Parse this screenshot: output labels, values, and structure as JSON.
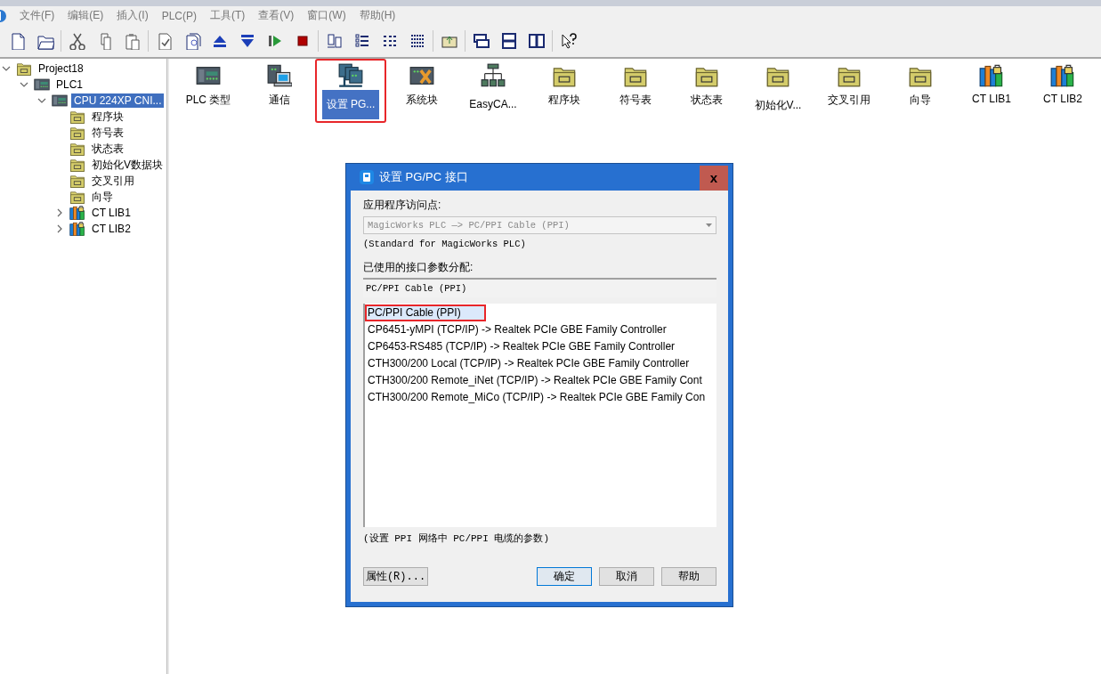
{
  "menu": [
    "文件(F)",
    "编辑(E)",
    "插入(I)",
    "PLC(P)",
    "工具(T)",
    "查看(V)",
    "窗口(W)",
    "帮助(H)"
  ],
  "tree": [
    {
      "label": "Project18",
      "kind": "project",
      "expanded": true,
      "selected": false,
      "children": [
        {
          "label": "PLC1",
          "kind": "plc",
          "expanded": true,
          "selected": false,
          "children": [
            {
              "label": "CPU 224XP CNI...",
              "kind": "plc",
              "expanded": true,
              "selected": true,
              "children": [
                {
                  "label": "程序块",
                  "kind": "folder",
                  "selected": false
                },
                {
                  "label": "符号表",
                  "kind": "folder",
                  "selected": false
                },
                {
                  "label": "状态表",
                  "kind": "folder",
                  "selected": false
                },
                {
                  "label": "初始化V数据块",
                  "kind": "folder",
                  "selected": false
                },
                {
                  "label": "交叉引用",
                  "kind": "folder",
                  "selected": false
                },
                {
                  "label": "向导",
                  "kind": "folder",
                  "selected": false
                },
                {
                  "label": "CT LIB1",
                  "kind": "library",
                  "expanded": false,
                  "selected": false
                },
                {
                  "label": "CT LIB2",
                  "kind": "library",
                  "expanded": false,
                  "selected": false
                }
              ]
            }
          ]
        }
      ]
    }
  ],
  "shortcuts": [
    {
      "label": "PLC 类型",
      "kind": "plc",
      "selected": false,
      "highlighted": false
    },
    {
      "label": "通信",
      "kind": "comm",
      "selected": false,
      "highlighted": false
    },
    {
      "label": "设置 PG...",
      "kind": "setpg",
      "selected": true,
      "highlighted": true
    },
    {
      "label": "系统块",
      "kind": "system",
      "selected": false,
      "highlighted": false
    },
    {
      "label": "EasyCA...",
      "kind": "network",
      "selected": false,
      "highlighted": false
    },
    {
      "label": "程序块",
      "kind": "folder",
      "selected": false,
      "highlighted": false
    },
    {
      "label": "符号表",
      "kind": "folder",
      "selected": false,
      "highlighted": false
    },
    {
      "label": "状态表",
      "kind": "folder",
      "selected": false,
      "highlighted": false
    },
    {
      "label": "初始化V...",
      "kind": "folder",
      "selected": false,
      "highlighted": false
    },
    {
      "label": "交叉引用",
      "kind": "folder",
      "selected": false,
      "highlighted": false
    },
    {
      "label": "向导",
      "kind": "folder",
      "selected": false,
      "highlighted": false
    },
    {
      "label": "CT LIB1",
      "kind": "library",
      "selected": false,
      "highlighted": false
    },
    {
      "label": "CT LIB2",
      "kind": "library",
      "selected": false,
      "highlighted": false
    }
  ],
  "dialog": {
    "title": "设置 PG/PC 接口",
    "close": "x",
    "access_label": "应用程序访问点:",
    "access_point": {
      "value": "MagicWorks PLC —> PC/PPI Cable (PPI)",
      "disabled": true
    },
    "access_note": "(Standard for MagicWorks PLC)",
    "params_label": "已使用的接口参数分配:",
    "params_value": "PC/PPI Cable (PPI)",
    "interfaces": [
      {
        "label": "PC/PPI Cable (PPI)",
        "selected": true,
        "highlighted": true
      },
      {
        "label": "CP6451-yMPI (TCP/IP) -> Realtek PCIe GBE Family Controller",
        "selected": false,
        "highlighted": false
      },
      {
        "label": "CP6453-RS485 (TCP/IP) -> Realtek PCIe GBE Family Controller",
        "selected": false,
        "highlighted": false
      },
      {
        "label": "CTH300/200 Local (TCP/IP) -> Realtek PCIe GBE Family Controller",
        "selected": false,
        "highlighted": false
      },
      {
        "label": "CTH300/200 Remote_iNet (TCP/IP) -> Realtek PCIe GBE Family Cont",
        "selected": false,
        "highlighted": false
      },
      {
        "label": "CTH300/200 Remote_MiCo (TCP/IP) -> Realtek PCIe GBE Family Con",
        "selected": false,
        "highlighted": false
      }
    ],
    "hint": "(设置 PPI 网络中 PC/PPI 电缆的参数)",
    "buttons": [
      {
        "label": "属性(R)...",
        "kind": "properties",
        "default": false
      },
      {
        "label": "确定",
        "kind": "ok",
        "default": true
      },
      {
        "label": "取消",
        "kind": "cancel",
        "default": false
      },
      {
        "label": "帮助",
        "kind": "help",
        "default": false
      }
    ]
  }
}
